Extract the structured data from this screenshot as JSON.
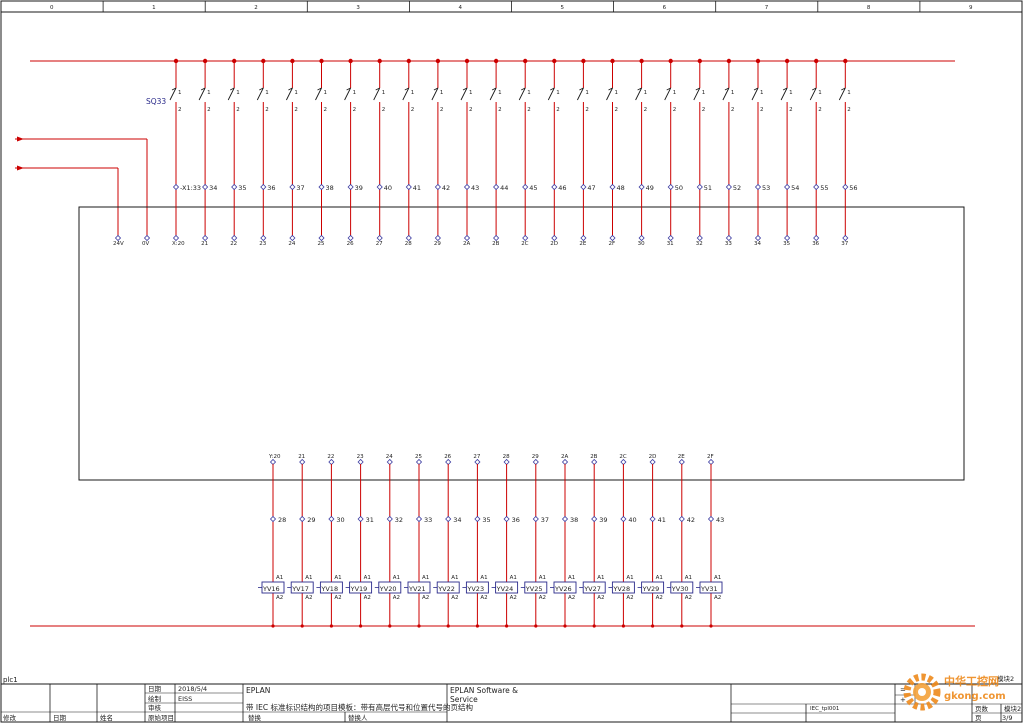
{
  "frame": {
    "columns": [
      "0",
      "1",
      "2",
      "3",
      "4",
      "5",
      "6",
      "7",
      "8",
      "9"
    ]
  },
  "switches": {
    "tag": "SQ33",
    "contact_top": "1",
    "contact_bottom": "2",
    "first_wire": "-X1:33",
    "wires": [
      "34",
      "35",
      "36",
      "37",
      "38",
      "39",
      "40",
      "41",
      "42",
      "43",
      "44",
      "45",
      "46",
      "47",
      "48",
      "49",
      "50",
      "51",
      "52",
      "53",
      "54",
      "55",
      "56"
    ]
  },
  "plc_inputs": {
    "supply": [
      "24V",
      "0V"
    ],
    "terminals": [
      "X:20",
      "21",
      "22",
      "23",
      "24",
      "25",
      "26",
      "27",
      "28",
      "29",
      "2A",
      "2B",
      "2C",
      "2D",
      "2E",
      "2F",
      "30",
      "31",
      "32",
      "33",
      "34",
      "35",
      "36",
      "37"
    ]
  },
  "plc_outputs": {
    "terminals": [
      "Y:20",
      "21",
      "22",
      "23",
      "24",
      "25",
      "26",
      "27",
      "28",
      "29",
      "2A",
      "2B",
      "2C",
      "2D",
      "2E",
      "2F"
    ],
    "wires": [
      "28",
      "29",
      "30",
      "31",
      "32",
      "33",
      "34",
      "35",
      "36",
      "37",
      "38",
      "39",
      "40",
      "41",
      "42",
      "43"
    ]
  },
  "valves": {
    "tags": [
      "YV16",
      "YV17",
      "YV18",
      "YV19",
      "YV20",
      "YV21",
      "YV22",
      "YV23",
      "YV24",
      "YV25",
      "YV26",
      "YV27",
      "YV28",
      "YV29",
      "YV30",
      "YV31"
    ],
    "pin_top": "A1",
    "pin_bottom": "A2"
  },
  "page_label": "plc1",
  "title_block": {
    "date_label": "日期",
    "date_value": "2018/5/4",
    "drawn_label": "绘制",
    "drawn_value": "EISS",
    "check_label": "审核",
    "original_label": "原始项目",
    "modify_label": "修改",
    "date_col_label": "日期",
    "name_label": "姓名",
    "company": "EPLAN",
    "description": "带 IEC 标准标识结构的项目模板：带有高层代号和位置代号的页结构",
    "replace_label": "替换",
    "replaced_by_label": "替换人",
    "vendor_line1": "EPLAN Software &",
    "vendor_line2": "Service",
    "drawing_no": "IEC_tpl001",
    "equal_sign": "=",
    "plus_sign": "+",
    "sheet_label": "页数",
    "sheet_value": "模块2",
    "page_row_label": "页",
    "page_value": "3/9",
    "corner_note": "模块2"
  },
  "watermark": {
    "brand": "中华工控网",
    "url": "gkong.com"
  },
  "colors": {
    "wire": "#cc0000",
    "ink": "#1a1a1a",
    "tag": "#2a2a8a",
    "terminal_blue": "#3a3aa0",
    "watermark": "#ee8a1c"
  }
}
